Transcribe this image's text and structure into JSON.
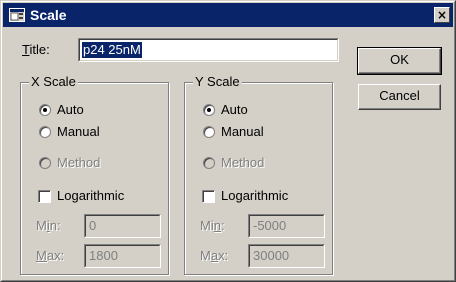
{
  "window": {
    "title": "Scale",
    "close_glyph": "×",
    "icon": "app-window-icon"
  },
  "title_field": {
    "label_prefix": "",
    "label_mnemonic": "T",
    "label_rest": "itle:",
    "value": "p24 25nM"
  },
  "buttons": {
    "ok": "OK",
    "cancel": "Cancel"
  },
  "x_scale": {
    "legend": "X Scale",
    "auto": "Auto",
    "manual": "Manual",
    "method": "Method",
    "logarithmic": "Logarithmic",
    "selected": "Auto",
    "logarithmic_checked": false,
    "min_label_prefix": "M",
    "min_label_mnemonic": "i",
    "min_label_rest": "n:",
    "max_label_prefix": "",
    "max_label_mnemonic": "M",
    "max_label_rest": "ax:",
    "min": "0",
    "max": "1800"
  },
  "y_scale": {
    "legend": "Y Scale",
    "auto": "Auto",
    "manual": "Manual",
    "method": "Method",
    "logarithmic": "Logarithmic",
    "selected": "Auto",
    "logarithmic_checked": false,
    "min_label_prefix": "Mi",
    "min_label_mnemonic": "n",
    "min_label_rest": ":",
    "max_label_prefix": "M",
    "max_label_mnemonic": "a",
    "max_label_rest": "x:",
    "min": "-5000",
    "max": "30000"
  }
}
